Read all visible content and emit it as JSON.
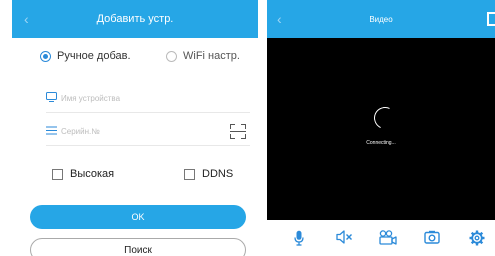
{
  "add_device": {
    "title": "Добавить устр.",
    "back_glyph": "‹",
    "mode_manual": "Ручное добав.",
    "mode_wifi": "WiFi настр.",
    "device_name_placeholder": "Имя устройства",
    "serial_placeholder": "Серийн.№",
    "high_quality_label": "Высокая",
    "ddns_label": "DDNS",
    "ok_label": "OK",
    "search_label": "Поиск"
  },
  "video": {
    "title": "Видео",
    "back_glyph": "‹",
    "status": "Connecting..."
  },
  "colors": {
    "accent": "#26a6e6",
    "icon": "#2b8ad9"
  }
}
